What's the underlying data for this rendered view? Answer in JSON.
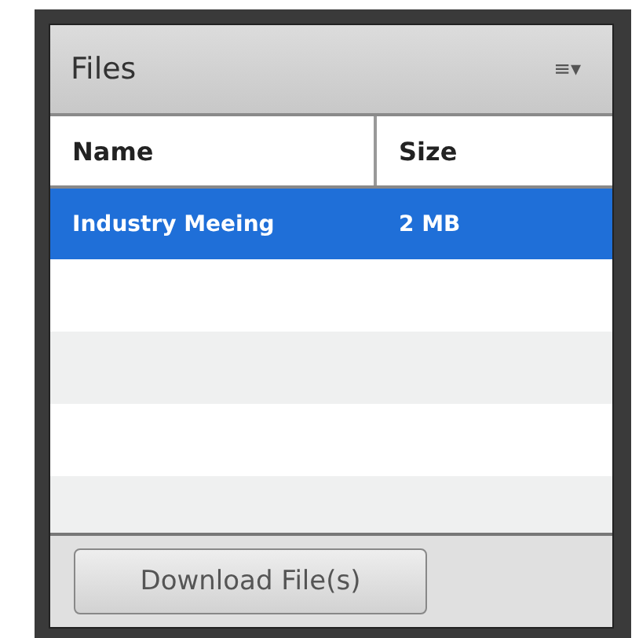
{
  "panel": {
    "title": "Files",
    "menu_icon": "≡▾"
  },
  "table": {
    "columns": [
      "Name",
      "Size"
    ],
    "rows": [
      {
        "name": "Industry Meeing",
        "size": "2 MB",
        "selected": true
      }
    ]
  },
  "buttons": [
    "Download File(s)"
  ]
}
